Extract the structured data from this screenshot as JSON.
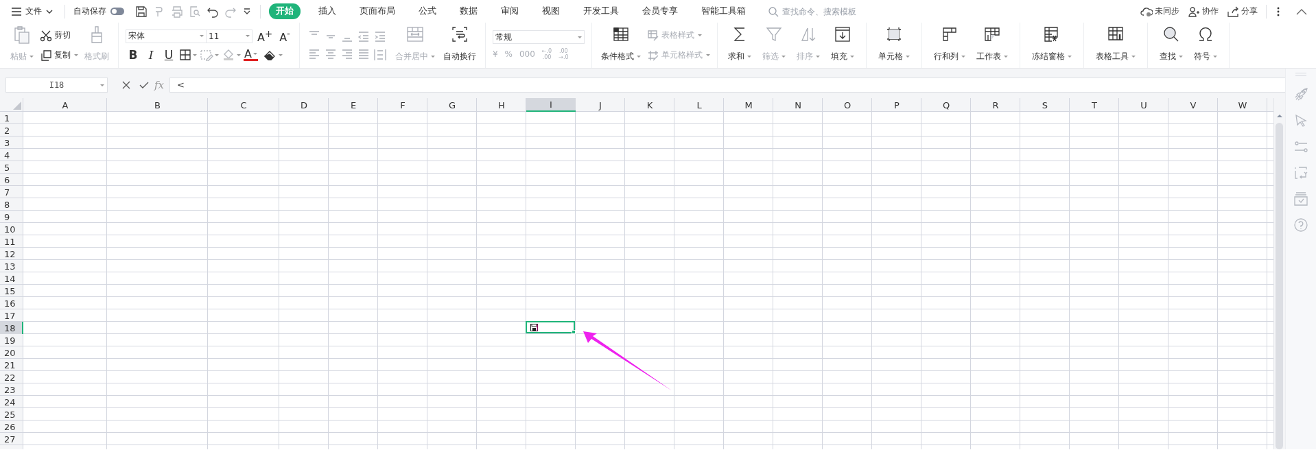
{
  "top_bar": {
    "file_menu": {
      "label": "文件"
    },
    "autosave": {
      "label": "自动保存",
      "on": false
    },
    "tabs": [
      {
        "label": "开始",
        "selected": true
      },
      {
        "label": "插入",
        "selected": false
      },
      {
        "label": "页面布局",
        "selected": false
      },
      {
        "label": "公式",
        "selected": false
      },
      {
        "label": "数据",
        "selected": false
      },
      {
        "label": "审阅",
        "selected": false
      },
      {
        "label": "视图",
        "selected": false
      },
      {
        "label": "开发工具",
        "selected": false
      },
      {
        "label": "会员专享",
        "selected": false
      },
      {
        "label": "智能工具箱",
        "selected": false
      }
    ],
    "search": {
      "placeholder": "查找命令、搜索模板"
    },
    "actions": [
      {
        "label": "未同步"
      },
      {
        "label": "协作"
      },
      {
        "label": "分享"
      }
    ]
  },
  "ribbon": {
    "paste": {
      "label": "粘贴",
      "disabled": true
    },
    "cut": {
      "label": "剪切",
      "disabled": false
    },
    "copy": {
      "label": "复制",
      "disabled": false
    },
    "format_painter": {
      "label": "格式刷",
      "disabled": true
    },
    "font_name": "宋体",
    "font_size": "11",
    "size_buttons": [
      "A$^{+}$",
      "A$^{-}$"
    ],
    "style_buttons": [
      {
        "label": "B"
      },
      {
        "label": "I"
      },
      {
        "label": "U"
      }
    ],
    "font_color": {
      "label": "A"
    },
    "merge": {
      "label": "合并居中",
      "disabled": true
    },
    "wrap_text": {
      "label": "自动换行",
      "disabled": false
    },
    "number_format": "常规",
    "number_buttons": [
      {
        "label": "¥"
      },
      {
        "label": "%"
      },
      {
        "label": "000"
      },
      {
        "label": "←.0\n.00"
      },
      {
        "label": ".00\n→.0"
      }
    ],
    "conditional_format": {
      "label": "条件格式",
      "disabled": false
    },
    "table_style": {
      "label": "表格样式",
      "disabled": true
    },
    "cell_style": {
      "label": "单元格样式",
      "disabled": true
    },
    "tools": [
      {
        "label": "求和",
        "disabled": false
      },
      {
        "label": "筛选",
        "disabled": true
      },
      {
        "label": "排序",
        "disabled": true
      },
      {
        "label": "填充",
        "disabled": false
      },
      {
        "label": "单元格",
        "disabled": false
      },
      {
        "label": "行和列",
        "disabled": false
      },
      {
        "label": "工作表",
        "disabled": false
      },
      {
        "label": "冻结窗格",
        "disabled": false
      },
      {
        "label": "表格工具",
        "disabled": false
      },
      {
        "label": "查找",
        "disabled": false
      },
      {
        "label": "符号",
        "disabled": false
      }
    ]
  },
  "formula_bar": {
    "name_box": "I18",
    "function_label": "fx",
    "formula": "<"
  },
  "sheet": {
    "columns": [
      {
        "label": "A",
        "selected": false
      },
      {
        "label": "B",
        "selected": false
      },
      {
        "label": "C",
        "selected": false
      },
      {
        "label": "D",
        "selected": false
      },
      {
        "label": "E",
        "selected": false
      },
      {
        "label": "F",
        "selected": false
      },
      {
        "label": "G",
        "selected": false
      },
      {
        "label": "H",
        "selected": false
      },
      {
        "label": "I",
        "selected": true
      },
      {
        "label": "J",
        "selected": false
      },
      {
        "label": "K",
        "selected": false
      },
      {
        "label": "L",
        "selected": false
      },
      {
        "label": "M",
        "selected": false
      },
      {
        "label": "N",
        "selected": false
      },
      {
        "label": "O",
        "selected": false
      },
      {
        "label": "P",
        "selected": false
      },
      {
        "label": "Q",
        "selected": false
      },
      {
        "label": "R",
        "selected": false
      },
      {
        "label": "S",
        "selected": false
      },
      {
        "label": "T",
        "selected": false
      },
      {
        "label": "U",
        "selected": false
      },
      {
        "label": "V",
        "selected": false
      },
      {
        "label": "W",
        "selected": false
      }
    ],
    "rows": [
      {
        "label": "1",
        "selected": false
      },
      {
        "label": "2",
        "selected": false
      },
      {
        "label": "3",
        "selected": false
      },
      {
        "label": "4",
        "selected": false
      },
      {
        "label": "5",
        "selected": false
      },
      {
        "label": "6",
        "selected": false
      },
      {
        "label": "7",
        "selected": false
      },
      {
        "label": "8",
        "selected": false
      },
      {
        "label": "9",
        "selected": false
      },
      {
        "label": "10",
        "selected": false
      },
      {
        "label": "11",
        "selected": false
      },
      {
        "label": "12",
        "selected": false
      },
      {
        "label": "13",
        "selected": false
      },
      {
        "label": "14",
        "selected": false
      },
      {
        "label": "15",
        "selected": false
      },
      {
        "label": "16",
        "selected": false
      },
      {
        "label": "17",
        "selected": false
      },
      {
        "label": "18",
        "selected": true
      },
      {
        "label": "19",
        "selected": false
      },
      {
        "label": "20",
        "selected": false
      },
      {
        "label": "21",
        "selected": false
      },
      {
        "label": "22",
        "selected": false
      },
      {
        "label": "23",
        "selected": false
      },
      {
        "label": "24",
        "selected": false
      },
      {
        "label": "25",
        "selected": false
      },
      {
        "label": "26",
        "selected": false
      },
      {
        "label": "27",
        "selected": false
      }
    ]
  }
}
